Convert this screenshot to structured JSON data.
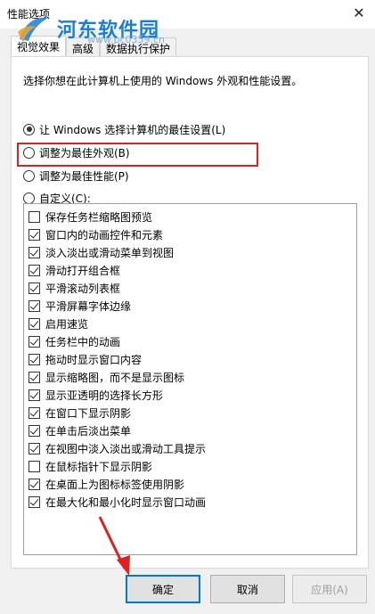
{
  "window": {
    "title": "性能选项",
    "close_glyph": "✕"
  },
  "watermark": {
    "text": "河东软件园",
    "url": "www.pc0359.cn"
  },
  "tabs": [
    {
      "label": "视觉效果",
      "active": true
    },
    {
      "label": "高级",
      "active": false
    },
    {
      "label": "数据执行保护",
      "active": false
    }
  ],
  "description": "选择你想在此计算机上使用的 Windows 外观和性能设置。",
  "radios": [
    {
      "label": "让 Windows 选择计算机的最佳设置(L)",
      "selected": true
    },
    {
      "label": "调整为最佳外观(B)",
      "selected": false,
      "highlighted": true
    },
    {
      "label": "调整为最佳性能(P)",
      "selected": false
    },
    {
      "label": "自定义(C):",
      "selected": false
    }
  ],
  "effects": [
    {
      "label": "保存任务栏缩略图预览",
      "checked": false
    },
    {
      "label": "窗口内的动画控件和元素",
      "checked": true
    },
    {
      "label": "淡入淡出或滑动菜单到视图",
      "checked": true
    },
    {
      "label": "滑动打开组合框",
      "checked": true
    },
    {
      "label": "平滑滚动列表框",
      "checked": true
    },
    {
      "label": "平滑屏幕字体边缘",
      "checked": true
    },
    {
      "label": "启用速览",
      "checked": true
    },
    {
      "label": "任务栏中的动画",
      "checked": true
    },
    {
      "label": "拖动时显示窗口内容",
      "checked": true
    },
    {
      "label": "显示缩略图，而不是显示图标",
      "checked": true
    },
    {
      "label": "显示亚透明的选择长方形",
      "checked": true
    },
    {
      "label": "在窗口下显示阴影",
      "checked": true
    },
    {
      "label": "在单击后淡出菜单",
      "checked": true
    },
    {
      "label": "在视图中淡入淡出或滑动工具提示",
      "checked": true
    },
    {
      "label": "在鼠标指针下显示阴影",
      "checked": false
    },
    {
      "label": "在桌面上为图标标签使用阴影",
      "checked": true
    },
    {
      "label": "在最大化和最小化时显示窗口动画",
      "checked": true
    }
  ],
  "buttons": {
    "ok": "确定",
    "cancel": "取消",
    "apply": "应用(A)"
  },
  "colors": {
    "annotation_red": "#e02020",
    "focus_blue": "#0078d7",
    "watermark_blue": "#1a7fd4"
  }
}
